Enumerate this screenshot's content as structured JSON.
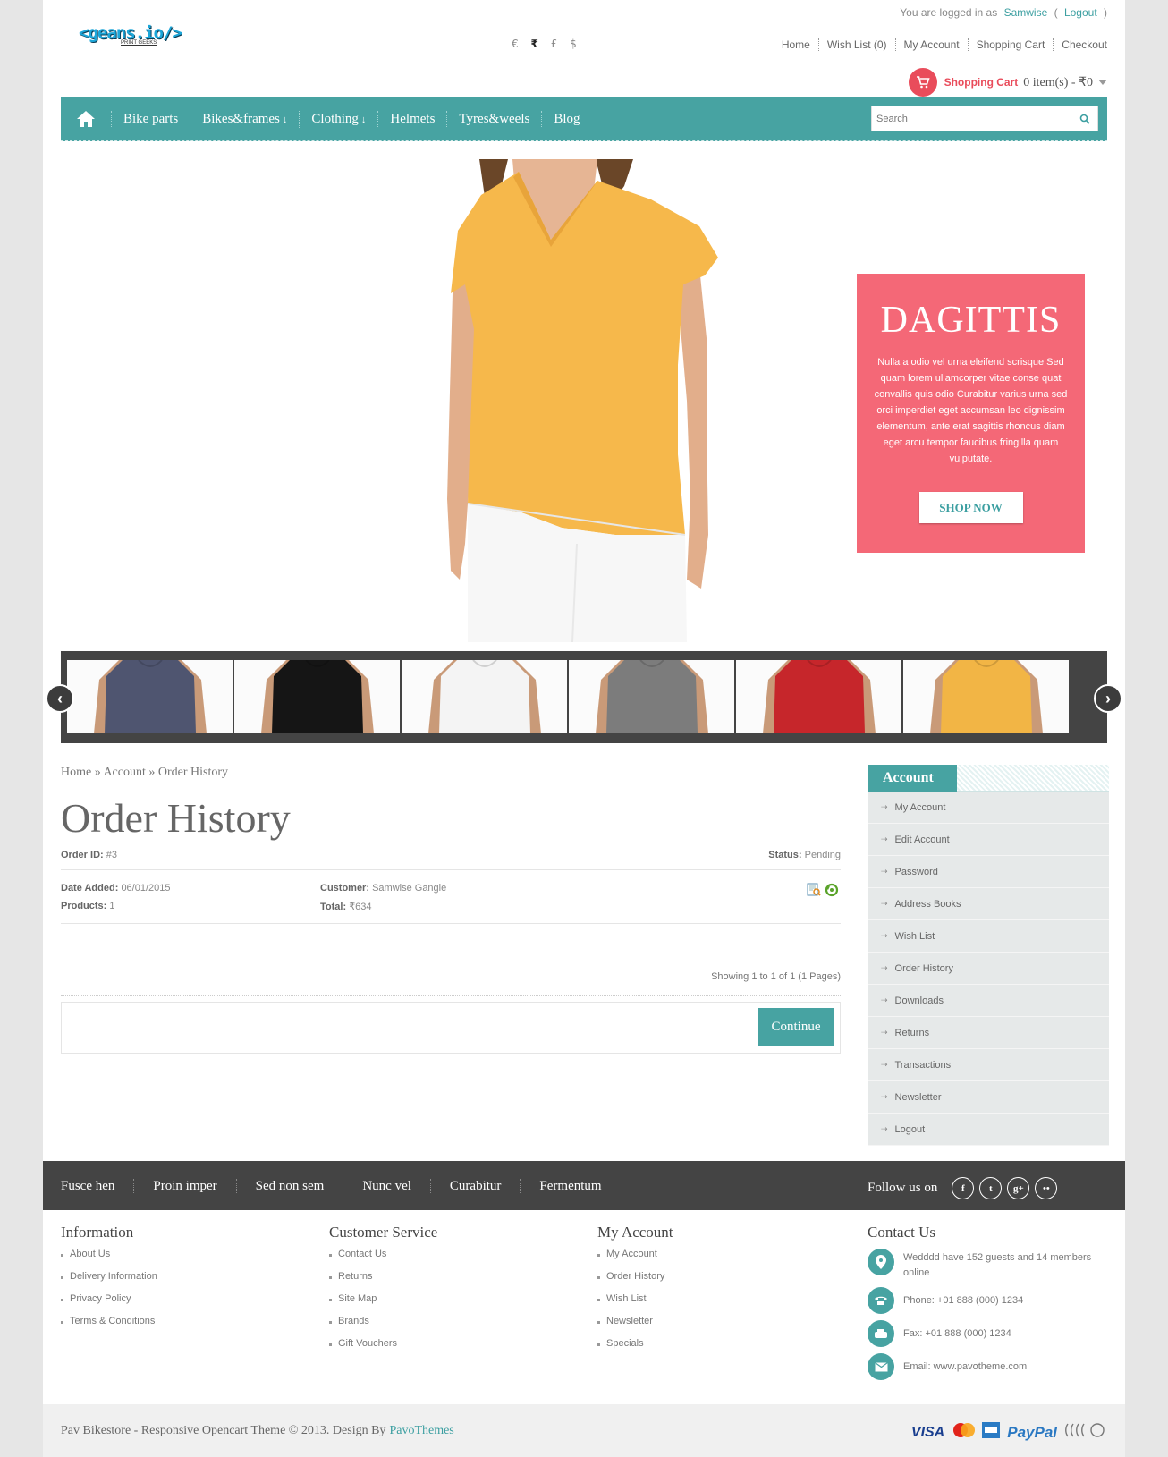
{
  "header": {
    "logo_text": "<geans.io/>",
    "logo_sub": "PRINT GEEKS",
    "login_prefix": "You are logged in as",
    "username": "Samwise",
    "logout_label": "Logout",
    "paren_open": "(",
    "paren_close": ")",
    "currencies": [
      "€",
      "₹",
      "£",
      "$"
    ],
    "top_links": [
      "Home",
      "Wish List (0)",
      "My Account",
      "Shopping Cart",
      "Checkout"
    ],
    "cart_label": "Shopping Cart",
    "cart_summary": "0 item(s) - ₹0"
  },
  "nav": {
    "items": [
      {
        "label": "Bike parts",
        "dropdown": ""
      },
      {
        "label": "Bikes&frames",
        "dropdown": "↓"
      },
      {
        "label": "Clothing",
        "dropdown": "↓"
      },
      {
        "label": "Helmets",
        "dropdown": ""
      },
      {
        "label": "Tyres&weels",
        "dropdown": ""
      },
      {
        "label": "Blog",
        "dropdown": ""
      }
    ],
    "search_placeholder": "Search"
  },
  "hero": {
    "promo_title": "DAGITTIS",
    "promo_text": "Nulla a odio vel urna eleifend scrisque Sed quam lorem ullamcorper vitae conse quat convallis quis odio Curabitur varius urna sed orci imperdiet eget accumsan leo dignissim elementum, ante erat sagittis rhoncus diam eget arcu tempor faucibus fringilla quam vulputate.",
    "promo_button": "SHOP NOW"
  },
  "thumbs": {
    "shirt_colors": [
      "#4f5570",
      "#151515",
      "#f4f4f4",
      "#7c7c7c",
      "#c6262b",
      "#f2b545"
    ],
    "prev": "‹",
    "next": "›"
  },
  "main": {
    "breadcrumb": "Home » Account » Order History",
    "title": "Order History",
    "order": {
      "id_label": "Order ID:",
      "id_value": "#3",
      "status_label": "Status:",
      "status_value": "Pending",
      "date_label": "Date Added:",
      "date_value": "06/01/2015",
      "products_label": "Products:",
      "products_value": "1",
      "customer_label": "Customer:",
      "customer_value": "Samwise Gangie",
      "total_label": "Total:",
      "total_value": "₹634"
    },
    "showing": "Showing 1 to 1 of 1 (1 Pages)",
    "continue_label": "Continue"
  },
  "sidebar": {
    "title": "Account",
    "items": [
      "My Account",
      "Edit Account",
      "Password",
      "Address Books",
      "Wish List",
      "Order History",
      "Downloads",
      "Returns",
      "Transactions",
      "Newsletter",
      "Logout"
    ]
  },
  "footer": {
    "bar_links": [
      "Fusce hen",
      "Proin imper",
      "Sed non sem",
      "Nunc vel",
      "Curabitur",
      "Fermentum"
    ],
    "follow_label": "Follow us on",
    "social": [
      "f",
      "t",
      "g+",
      "••"
    ],
    "info_title": "Information",
    "info_links": [
      "About Us",
      "Delivery Information",
      "Privacy Policy",
      "Terms & Conditions"
    ],
    "service_title": "Customer Service",
    "service_links": [
      "Contact Us",
      "Returns",
      "Site Map",
      "Brands",
      "Gift Vouchers"
    ],
    "account_title": "My Account",
    "account_links": [
      "My Account",
      "Order History",
      "Wish List",
      "Newsletter",
      "Specials"
    ],
    "contact_title": "Contact Us",
    "contact_online": "Wedddd have 152 guests and 14 members online",
    "contact_phone": "Phone: +01 888 (000) 1234",
    "contact_fax": "Fax: +01 888 (000) 1234",
    "contact_email": "Email: www.pavotheme.com",
    "copyright": "Pav Bikestore - Responsive Opencart Theme © 2013. Design By",
    "copyright_link": "PavoThemes",
    "pay_visa": "VISA",
    "pay_paypal": "PayPal"
  }
}
